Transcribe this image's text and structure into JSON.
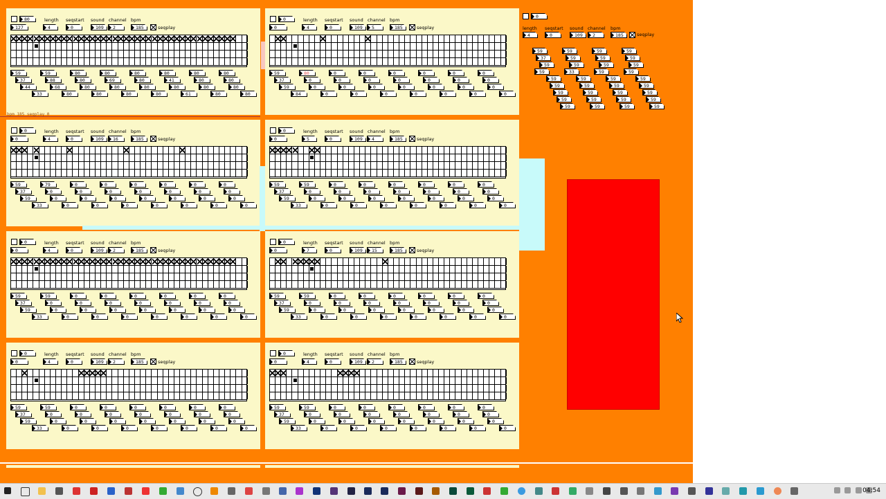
{
  "header_labels": {
    "length": "length",
    "seqstart": "seqstart",
    "sound": "sound",
    "channel": "channel",
    "bpm": "bpm",
    "seqplay": "seqplay"
  },
  "status_text": "bpm 185 seqplay 0",
  "panels": [
    {
      "id": "p1",
      "top_num": "80",
      "length": "127",
      "l": "4",
      "seqstart": "0",
      "sound": "109",
      "channel": "2",
      "bpm": "185",
      "seqplay_on": true,
      "rows": [
        [
          "59",
          "59",
          "80",
          "80",
          "80",
          "80",
          "80",
          "80"
        ],
        [
          "37",
          "88",
          "80",
          "69",
          "80",
          "41",
          "80",
          "80"
        ],
        [
          "44",
          "68",
          "80",
          "80",
          "80",
          "80",
          "80",
          "80"
        ],
        [
          "33",
          "80",
          "80",
          "80",
          "80",
          "61",
          "80",
          "80"
        ]
      ],
      "xmask": "1111111111111111111111111111111111111111",
      "dotcol": 4
    },
    {
      "id": "p2",
      "top_num": "0",
      "length": "0",
      "l": "4",
      "seqstart": "0",
      "sound": "109",
      "channel": "5",
      "bpm": "185",
      "seqplay_on": true,
      "rows": [
        [
          "59",
          "80",
          "0",
          "0",
          "0",
          "0",
          "0",
          "0"
        ],
        [
          "37",
          "0",
          "0",
          "0",
          "0",
          "0",
          "0",
          "0"
        ],
        [
          "59",
          "0",
          "0",
          "0",
          "0",
          "0",
          "0",
          "0"
        ],
        [
          "84",
          "0",
          "0",
          "0",
          "0",
          "0",
          "0",
          "0"
        ]
      ],
      "xmask": "0110000001000000010000000000000000000000",
      "dotcol": 4
    },
    {
      "id": "p3",
      "top_num": "0",
      "length": "0",
      "l": "4",
      "seqstart": "0",
      "sound": "109",
      "channel": "16",
      "bpm": "185",
      "seqplay_on": true,
      "rows": [
        [
          "59",
          "79",
          "0",
          "0",
          "0",
          "0",
          "0",
          "0"
        ],
        [
          "37",
          "0",
          "0",
          "0",
          "0",
          "0",
          "0",
          "0"
        ],
        [
          "59",
          "0",
          "0",
          "0",
          "0",
          "0",
          "0",
          "0"
        ],
        [
          "33",
          "0",
          "0",
          "0",
          "0",
          "0",
          "0",
          "0"
        ]
      ],
      "xmask": "1110100000100000000010000000001000000000",
      "dotcol": 4
    },
    {
      "id": "p4",
      "top_num": "0",
      "length": "0",
      "l": "5",
      "seqstart": "0",
      "sound": "109",
      "channel": "4",
      "bpm": "185",
      "seqplay_on": true,
      "rows": [
        [
          "59",
          "59",
          "0",
          "0",
          "0",
          "0",
          "0",
          "0"
        ],
        [
          "37",
          "0",
          "0",
          "0",
          "0",
          "0",
          "0",
          "0"
        ],
        [
          "59",
          "0",
          "0",
          "0",
          "0",
          "0",
          "0",
          "0"
        ],
        [
          "33",
          "0",
          "0",
          "0",
          "0",
          "0",
          "0",
          "0"
        ]
      ],
      "xmask": "1111100110000000000000000000000000000000",
      "dotcol": 7
    },
    {
      "id": "p5",
      "top_num": "0",
      "length": "0",
      "l": "4",
      "seqstart": "0",
      "sound": "109",
      "channel": "2",
      "bpm": "185",
      "seqplay_on": true,
      "rows": [
        [
          "59",
          "59",
          "0",
          "0",
          "0",
          "0",
          "0",
          "0"
        ],
        [
          "37",
          "0",
          "0",
          "0",
          "0",
          "0",
          "0",
          "0"
        ],
        [
          "59",
          "0",
          "0",
          "0",
          "0",
          "0",
          "0",
          "0"
        ],
        [
          "33",
          "0",
          "0",
          "0",
          "0",
          "0",
          "0",
          "0"
        ]
      ],
      "xmask": "1111111111111111111111111111111111111111",
      "dotcol": 4
    },
    {
      "id": "p6",
      "top_num": "0",
      "length": "0",
      "l": "7",
      "seqstart": "0",
      "sound": "109",
      "channel": "15",
      "bpm": "185",
      "seqplay_on": true,
      "rows": [
        [
          "59",
          "59",
          "0",
          "0",
          "0",
          "0",
          "0",
          "0"
        ],
        [
          "37",
          "0",
          "0",
          "0",
          "0",
          "0",
          "0",
          "0"
        ],
        [
          "59",
          "0",
          "0",
          "0",
          "0",
          "0",
          "0",
          "0"
        ],
        [
          "33",
          "0",
          "0",
          "0",
          "0",
          "0",
          "0",
          "0"
        ]
      ],
      "xmask": "0110111110000000000010000000000000000000",
      "dotcol": 7
    },
    {
      "id": "p7",
      "top_num": "0",
      "length": "0",
      "l": "4",
      "seqstart": "0",
      "sound": "109",
      "channel": "2",
      "bpm": "185",
      "seqplay_on": true,
      "rows": [
        [
          "59",
          "59",
          "0",
          "0",
          "0",
          "0",
          "0",
          "0"
        ],
        [
          "37",
          "0",
          "0",
          "0",
          "0",
          "0",
          "0",
          "0"
        ],
        [
          "59",
          "0",
          "0",
          "0",
          "0",
          "0",
          "0",
          "0"
        ],
        [
          "33",
          "0",
          "0",
          "0",
          "0",
          "0",
          "0",
          "0"
        ]
      ],
      "xmask": "0010000000001111100000000000000000000000",
      "dotcol": 4
    },
    {
      "id": "p8",
      "top_num": "0",
      "length": "0",
      "l": "4",
      "seqstart": "0",
      "sound": "109",
      "channel": "2",
      "bpm": "185",
      "seqplay_on": true,
      "rows": [
        [
          "59",
          "59",
          "0",
          "0",
          "0",
          "0",
          "0",
          "0"
        ],
        [
          "37",
          "0",
          "0",
          "0",
          "0",
          "0",
          "0",
          "0"
        ],
        [
          "59",
          "0",
          "0",
          "0",
          "0",
          "0",
          "0",
          "0"
        ],
        [
          "33",
          "0",
          "0",
          "0",
          "0",
          "0",
          "0",
          "0"
        ]
      ],
      "xmask": "1110000000001111000000000000000000000000",
      "dotcol": 4
    }
  ],
  "right_panel": {
    "top_num": "0",
    "l": "4",
    "seqstart": "0",
    "sound": "109",
    "channel": "2",
    "bpm": "185",
    "values": [
      "59",
      "59",
      "59",
      "59",
      "37",
      "59",
      "59",
      "59",
      "59",
      "59",
      "59",
      "59",
      "59",
      "33",
      "59",
      "59",
      "59",
      "59",
      "59",
      "59",
      "59",
      "59",
      "59",
      "59",
      "59",
      "59",
      "59",
      "59",
      "59",
      "59",
      "59",
      "59",
      "59",
      "59",
      "59",
      "59"
    ]
  },
  "taskbar": {
    "clock": "04:54"
  }
}
